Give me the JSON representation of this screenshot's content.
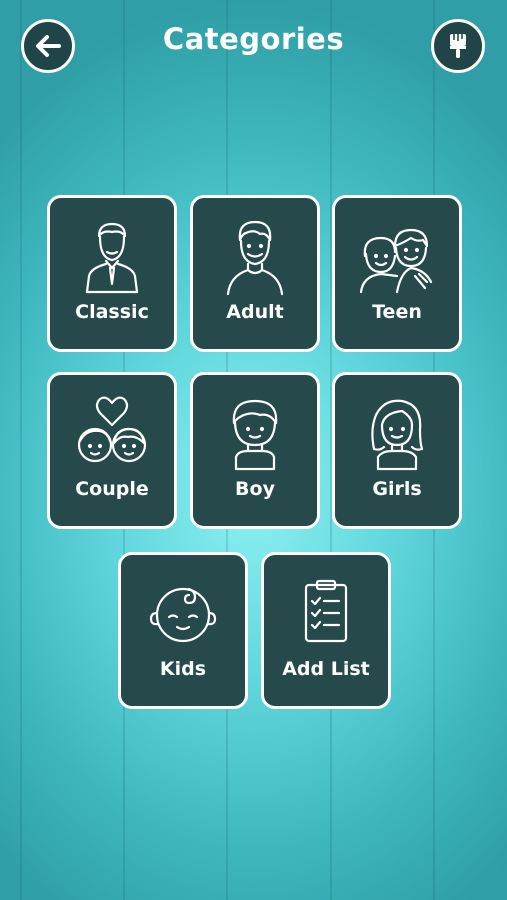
{
  "header": {
    "title": "Categories",
    "back_icon": "arrow-left-icon",
    "theme_icon": "paint-brush-icon"
  },
  "categories": [
    {
      "label": "Classic",
      "icon": "man-in-suit-icon"
    },
    {
      "label": "Adult",
      "icon": "adult-man-icon"
    },
    {
      "label": "Teen",
      "icon": "teen-friends-icon"
    },
    {
      "label": "Couple",
      "icon": "couple-heart-icon"
    },
    {
      "label": "Boy",
      "icon": "boy-icon"
    },
    {
      "label": "Girls",
      "icon": "girl-icon"
    },
    {
      "label": "Kids",
      "icon": "baby-icon"
    },
    {
      "label": "Add List",
      "icon": "clipboard-checklist-icon"
    }
  ],
  "colors": {
    "tile_bg": "#264a4c",
    "tile_border": "#ffffff",
    "background": "#5fd6dc"
  }
}
